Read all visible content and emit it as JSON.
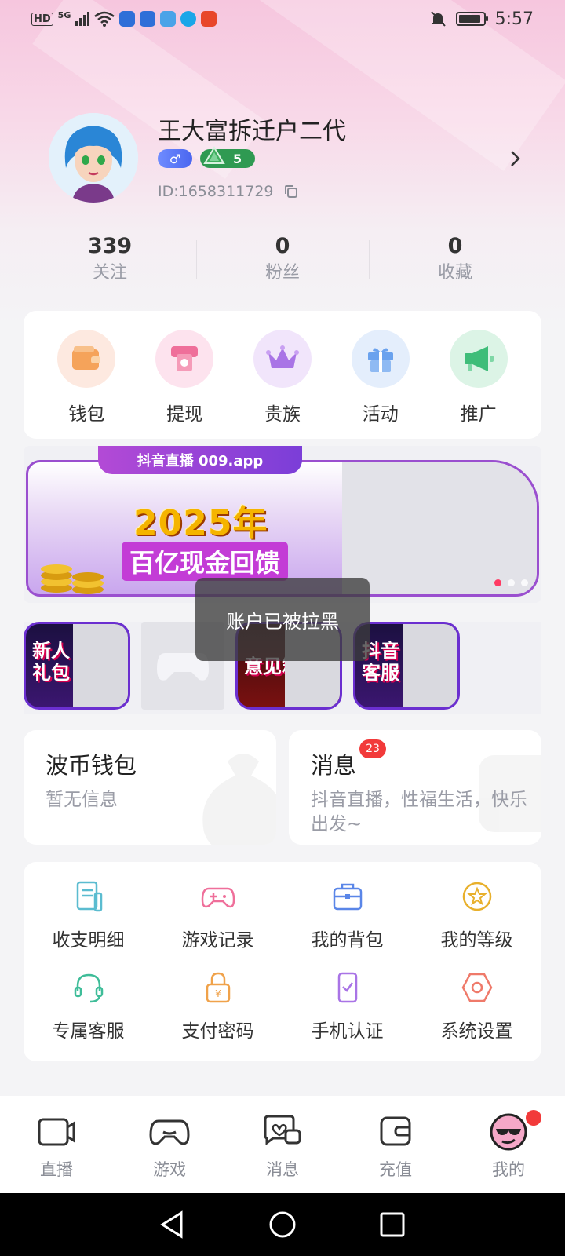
{
  "status_bar": {
    "network_tag": "HD",
    "network_type": "5G",
    "time": "5:57",
    "battery_level": 0.9,
    "app_icons": [
      "news-icon",
      "news-icon-2",
      "wallet-app-icon",
      "chat-app-icon",
      "shop-app-icon"
    ]
  },
  "profile": {
    "username": "王大富拆迁户二代",
    "gender_symbol": "♂",
    "level": "5",
    "user_id": "ID:1658311729"
  },
  "stats": [
    {
      "count": "339",
      "label": "关注"
    },
    {
      "count": "0",
      "label": "粉丝"
    },
    {
      "count": "0",
      "label": "收藏"
    }
  ],
  "quick_actions": [
    {
      "label": "钱包",
      "icon": "wallet-icon",
      "bg": "#fde9e0",
      "color": "#f5a35a"
    },
    {
      "label": "提现",
      "icon": "withdraw-icon",
      "bg": "#fde3ee",
      "color": "#ef6f9a"
    },
    {
      "label": "贵族",
      "icon": "crown-icon",
      "bg": "#f1e5fb",
      "color": "#a974e6"
    },
    {
      "label": "活动",
      "icon": "gift-icon",
      "bg": "#e4eefc",
      "color": "#6aa2ee"
    },
    {
      "label": "推广",
      "icon": "megaphone-icon",
      "bg": "#dcf4e6",
      "color": "#3fbd79"
    }
  ],
  "banner": {
    "tab_text": "抖音直播 009.app",
    "headline": "2025年",
    "subline": "百亿现金回馈",
    "active_slide": 1,
    "slide_count": 3
  },
  "tiles": [
    {
      "label": "新人礼包",
      "style": "promo"
    },
    {
      "label": "",
      "style": "placeholder",
      "icon": "gamepad-icon"
    },
    {
      "label": "意见箱",
      "style": "red"
    },
    {
      "label": "抖音客服",
      "style": "promo"
    }
  ],
  "toast": {
    "text": "账户已被拉黑"
  },
  "wallet_card": {
    "title": "波币钱包",
    "subtitle": "暂无信息"
  },
  "message_card": {
    "title": "消息",
    "count": "23",
    "subtitle": "抖音直播，性福生活，快乐出发~"
  },
  "functions": [
    {
      "label": "收支明细",
      "icon": "ledger-icon",
      "color": "#5bbcd0"
    },
    {
      "label": "游戏记录",
      "icon": "gamepad-icon",
      "color": "#ef6f9a"
    },
    {
      "label": "我的背包",
      "icon": "backpack-icon",
      "color": "#5a86e8"
    },
    {
      "label": "我的等级",
      "icon": "level-star-icon",
      "color": "#e8b02c"
    },
    {
      "label": "专属客服",
      "icon": "headset-icon",
      "color": "#3fbd99"
    },
    {
      "label": "支付密码",
      "icon": "lock-icon",
      "color": "#f0a24a"
    },
    {
      "label": "手机认证",
      "icon": "phone-verify-icon",
      "color": "#a974e6"
    },
    {
      "label": "系统设置",
      "icon": "settings-hex-icon",
      "color": "#ef7a6a"
    }
  ],
  "bottom_nav": [
    {
      "label": "直播",
      "icon": "live-icon"
    },
    {
      "label": "游戏",
      "icon": "gamepad-icon"
    },
    {
      "label": "消息",
      "icon": "message-icon"
    },
    {
      "label": "充值",
      "icon": "recharge-icon"
    },
    {
      "label": "我的",
      "icon": "me-avatar-icon",
      "active": true
    }
  ],
  "colors": {
    "accent_pink": "#f6c6de",
    "badge_red": "#f23a3a",
    "level_green": "#2f9a52",
    "gender_blue": "#5a78f5"
  }
}
